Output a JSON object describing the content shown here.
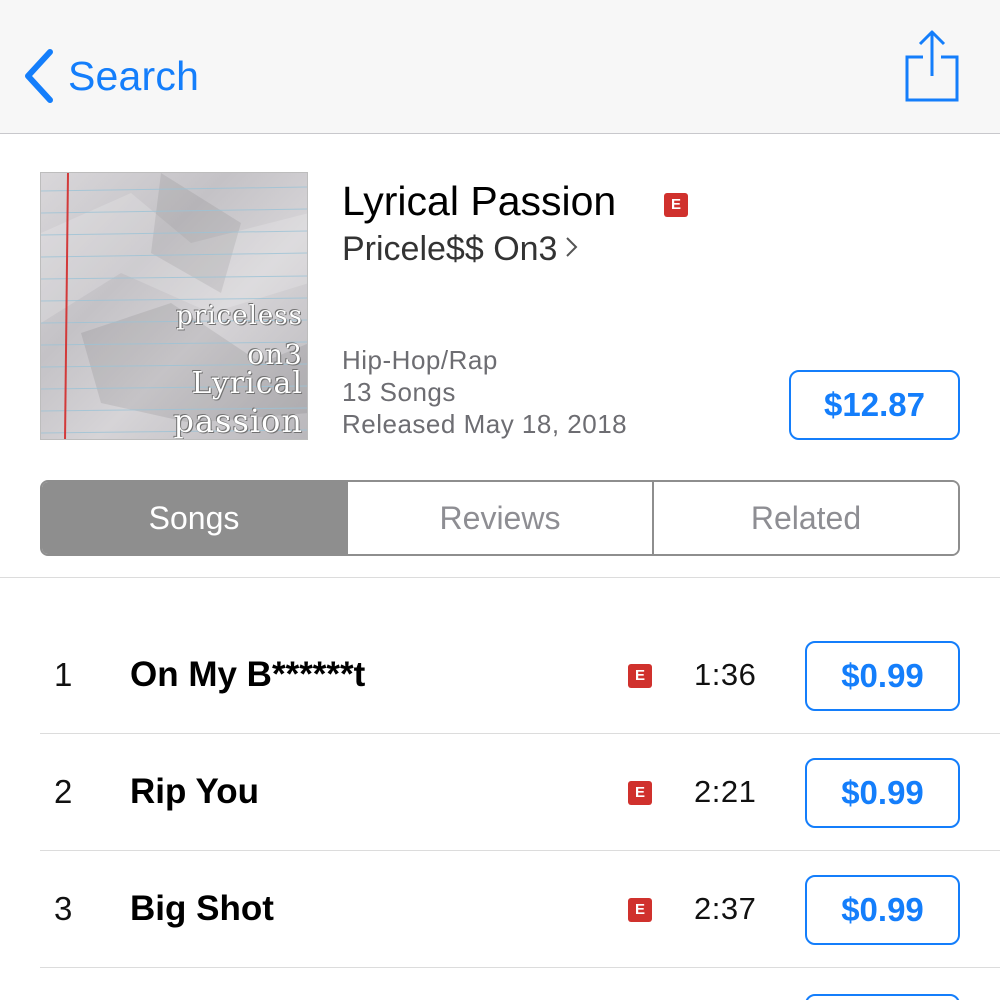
{
  "nav": {
    "back_label": "Search",
    "back_icon": "chevron-left-icon",
    "share_icon": "share-icon",
    "accent_color": "#147efb"
  },
  "album": {
    "title": "Lyrical Passion",
    "explicit_badge": "E",
    "artist": "Pricele$$ On3",
    "artwork_text": [
      "priceless",
      "on3",
      "Lyrical",
      "passion"
    ],
    "genre": "Hip-Hop/Rap",
    "song_count": "13 Songs",
    "released": "Released May 18, 2018",
    "price": "$12.87"
  },
  "tabs": [
    {
      "label": "Songs",
      "active": true
    },
    {
      "label": "Reviews",
      "active": false
    },
    {
      "label": "Related",
      "active": false
    }
  ],
  "tracks": [
    {
      "number": "1",
      "title": "On My B******t",
      "explicit": "E",
      "duration": "1:36",
      "price": "$0.99"
    },
    {
      "number": "2",
      "title": "Rip You",
      "explicit": "E",
      "duration": "2:21",
      "price": "$0.99"
    },
    {
      "number": "3",
      "title": "Big Shot",
      "explicit": "E",
      "duration": "2:37",
      "price": "$0.99"
    }
  ],
  "colors": {
    "accent": "#147efb",
    "explicit_badge": "#d0312d",
    "segment_active": "#8e8e8e"
  }
}
